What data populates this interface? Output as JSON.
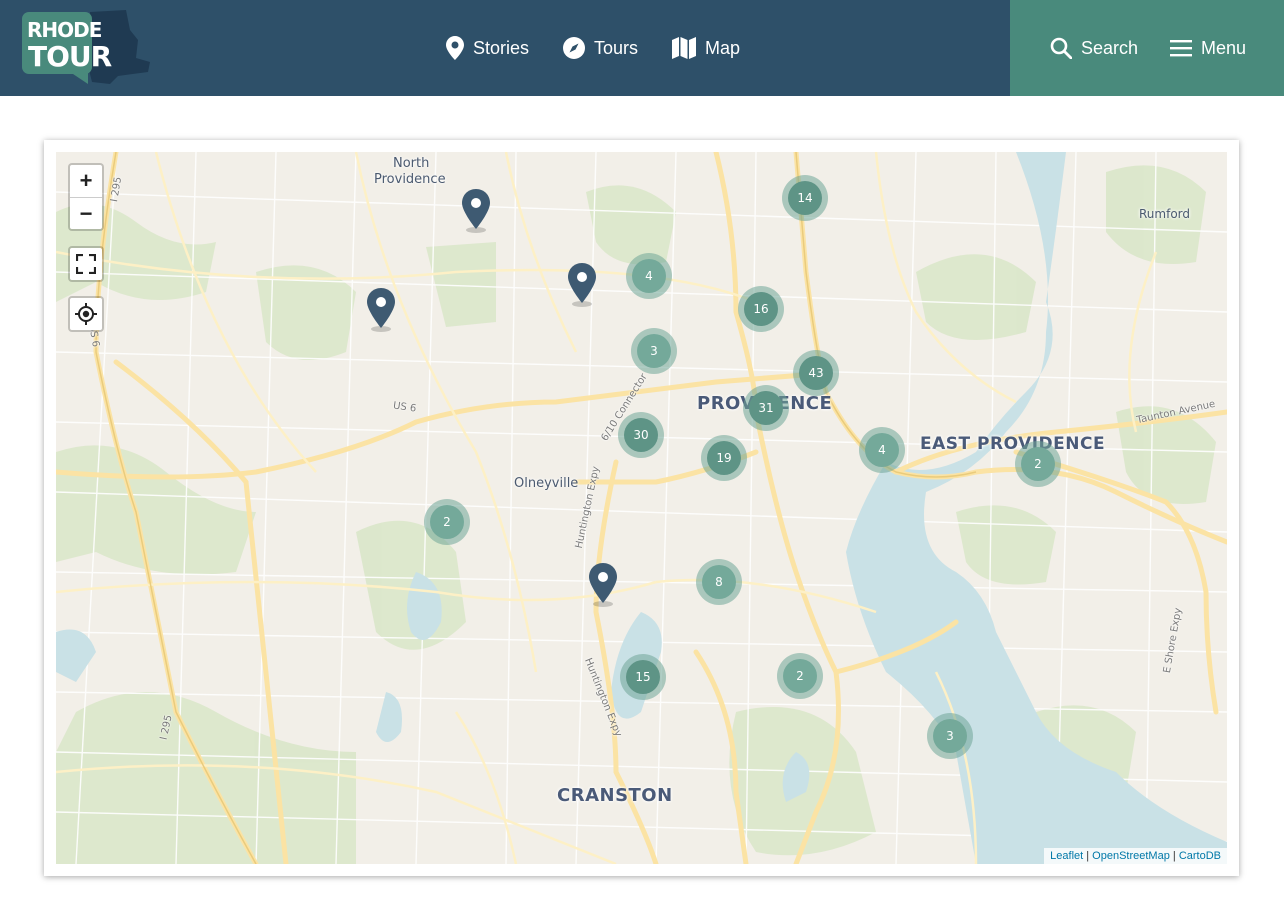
{
  "logo": {
    "line1": "RHODE",
    "line2": "TOUR"
  },
  "nav": [
    {
      "label": "Stories",
      "icon": "map-pin-icon"
    },
    {
      "label": "Tours",
      "icon": "compass-icon"
    },
    {
      "label": "Map",
      "icon": "folded-map-icon"
    }
  ],
  "search": {
    "label": "Search",
    "icon": "search-icon"
  },
  "menu": {
    "label": "Menu",
    "icon": "hamburger-icon"
  },
  "colors": {
    "header": "#2e5069",
    "accent": "#498a7c",
    "cluster": "#74a99a",
    "pin": "#3e5a72"
  },
  "map": {
    "controls": {
      "zoom_in": "+",
      "zoom_out": "−"
    },
    "places": [
      {
        "text": "North"
      },
      {
        "text": "Providence"
      },
      {
        "text": "Rumford"
      },
      {
        "text": "PROVIDENCE"
      },
      {
        "text": "EAST PROVIDENCE"
      },
      {
        "text": "Olneyville"
      },
      {
        "text": "CRANSTON"
      }
    ],
    "roads": [
      {
        "text": "US 6"
      },
      {
        "text": "6/10 Connector"
      },
      {
        "text": "Huntington Expy"
      },
      {
        "text": "Huntington Expy"
      },
      {
        "text": "Taunton Avenue"
      },
      {
        "text": "I 295"
      },
      {
        "text": "I 295"
      },
      {
        "text": "US 6"
      },
      {
        "text": "E Shore Expy"
      }
    ],
    "clusters": [
      {
        "count": "14"
      },
      {
        "count": "4"
      },
      {
        "count": "16"
      },
      {
        "count": "3"
      },
      {
        "count": "43"
      },
      {
        "count": "31"
      },
      {
        "count": "30"
      },
      {
        "count": "19"
      },
      {
        "count": "4"
      },
      {
        "count": "2"
      },
      {
        "count": "2"
      },
      {
        "count": "8"
      },
      {
        "count": "15"
      },
      {
        "count": "2"
      },
      {
        "count": "3"
      }
    ],
    "attribution": {
      "leaflet": "Leaflet",
      "osm": "OpenStreetMap",
      "carto": "CartoDB"
    }
  }
}
